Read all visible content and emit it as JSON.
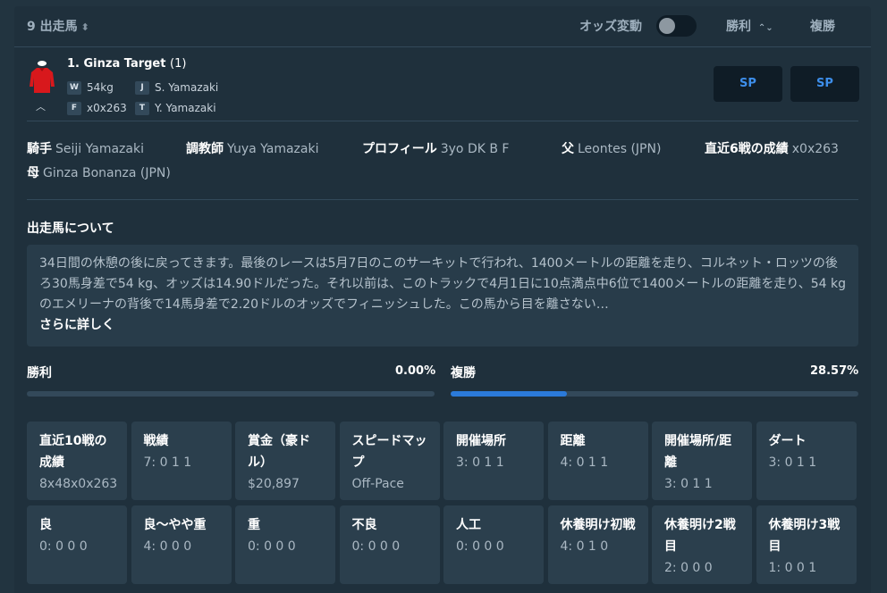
{
  "header": {
    "count_label": "9 出走馬",
    "sort_icon": "sort-icon",
    "odds_change_label": "オッズ変動",
    "odds_toggle_on": false,
    "win_label": "勝利",
    "place_label": "複勝"
  },
  "runner": {
    "name": "1. Ginza Target",
    "barrier": "(1)",
    "weight_tag": "W",
    "weight": "54kg",
    "jockey_tag": "J",
    "jockey": "S. Yamazaki",
    "form_tag": "F",
    "form": "x0x263",
    "trainer_tag": "T",
    "trainer": "Y. Yamazaki",
    "win_odds": "SP",
    "place_odds": "SP",
    "silks_colors": {
      "body": "#d8181c",
      "cap": "#ffffff"
    }
  },
  "details": {
    "jockey_label": "騎手",
    "jockey_value": "Seiji Yamazaki",
    "trainer_label": "調教師",
    "trainer_value": "Yuya Yamazaki",
    "profile_label": "プロフィール",
    "profile_value": "3yo DK B F",
    "sire_label": "父",
    "sire_value": "Leontes (JPN)",
    "last6_label": "直近6戦の成績",
    "last6_value": "x0x263",
    "dam_label": "母",
    "dam_value": "Ginza Bonanza (JPN)"
  },
  "about": {
    "title": "出走馬について",
    "text": "34日間の休憩の後に戻ってきます。最後のレースは5月7日のこのサーキットで行われ、1400メートルの距離を走り、コルネット・ロッツの後ろ30馬身差で54 kg、オッズは14.90ドルだった。それ以前は、このトラックで4月1日に10点満点中6位で1400メートルの距離を走り、54 kgのエメリーナの背後で14馬身差で2.20ドルのオッズでフィニッシュした。この馬から目を離さない…",
    "more_label": "さらに詳しく"
  },
  "stats": {
    "win_label": "勝利",
    "win_value": "0.00%",
    "win_fraction": 0.0,
    "place_label": "複勝",
    "place_value": "28.57%",
    "place_fraction": 0.2857,
    "accent_color": "#2b7ad9"
  },
  "grid": [
    {
      "title": "直近10戦の成績",
      "value": "8x48x0x263"
    },
    {
      "title": "戦績",
      "value": "7: 0 1 1"
    },
    {
      "title": "賞金（豪ドル）",
      "value": "$20,897"
    },
    {
      "title": "スピードマップ",
      "value": "Off-Pace"
    },
    {
      "title": "開催場所",
      "value": "3: 0 1 1"
    },
    {
      "title": "距離",
      "value": "4: 0 1 1"
    },
    {
      "title": "開催場所/距離",
      "value": "3: 0 1 1"
    },
    {
      "title": "ダート",
      "value": "3: 0 1 1"
    },
    {
      "title": "良",
      "value": "0: 0 0 0"
    },
    {
      "title": "良〜やや重",
      "value": "4: 0 0 0"
    },
    {
      "title": "重",
      "value": "0: 0 0 0"
    },
    {
      "title": "不良",
      "value": "0: 0 0 0"
    },
    {
      "title": "人工",
      "value": "0: 0 0 0"
    },
    {
      "title": "休養明け初戦",
      "value": "4: 0 1 0"
    },
    {
      "title": "休養明け2戦目",
      "value": "2: 0 0 0"
    },
    {
      "title": "休養明け3戦目",
      "value": "1: 0 0 1"
    }
  ]
}
